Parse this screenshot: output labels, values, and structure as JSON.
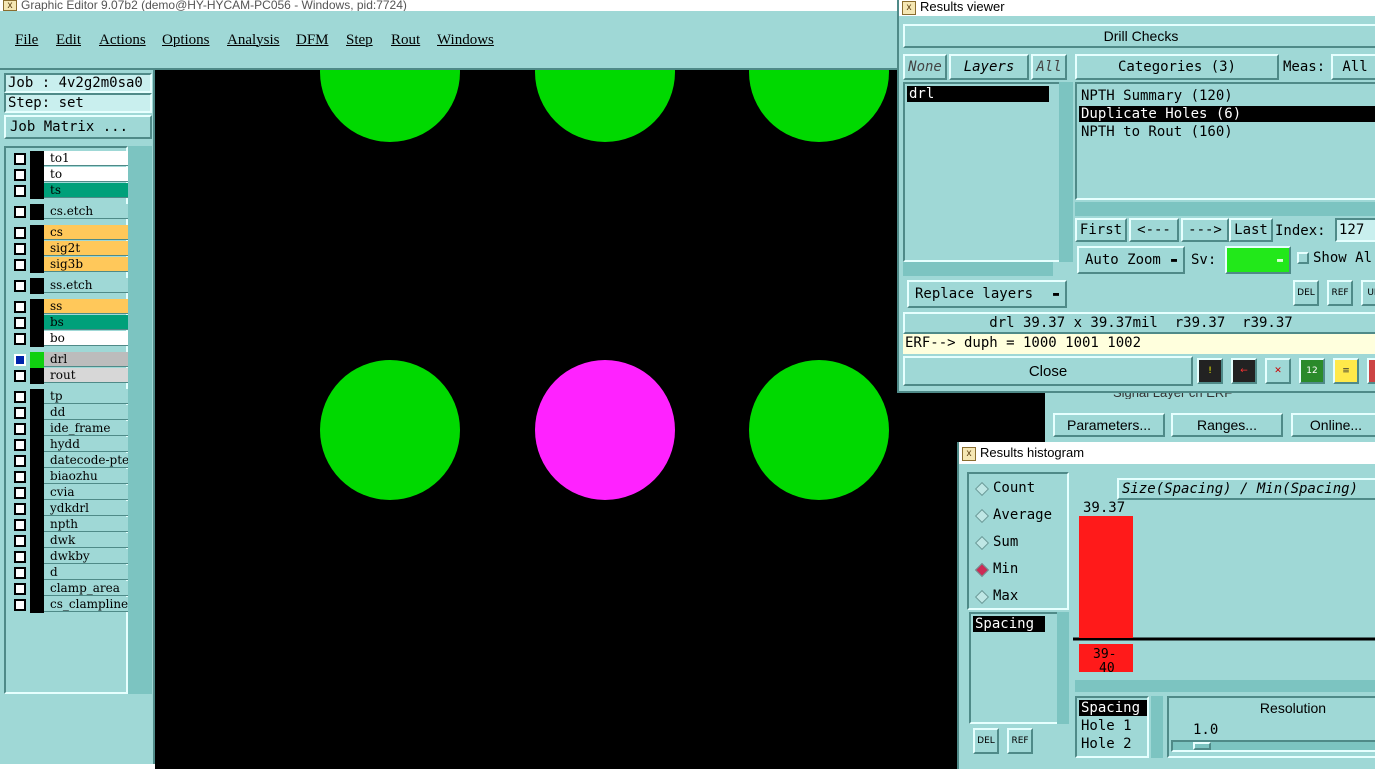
{
  "app": {
    "title": "Graphic Editor 9.07b2 (demo@HY-HYCAM-PC056 - Windows, pid:7724)",
    "menu": [
      "File",
      "Edit",
      "Actions",
      "Options",
      "Analysis",
      "DFM",
      "Step",
      "Rout",
      "Windows"
    ]
  },
  "side": {
    "job": "Job : 4v2g2m0sa0",
    "step": "Step: set",
    "job_matrix": "Job Matrix ...",
    "layers": [
      {
        "name": "to1",
        "color": "#ffffff"
      },
      {
        "name": "to",
        "color": "#ffffff"
      },
      {
        "name": "ts",
        "color": "#00a07a"
      },
      {
        "name": "cs.etch",
        "color": "#9fd8d6"
      },
      {
        "name": "cs",
        "color": "#ffc85a"
      },
      {
        "name": "sig2t",
        "color": "#ffc85a"
      },
      {
        "name": "sig3b",
        "color": "#ffc85a"
      },
      {
        "name": "ss.etch",
        "color": "#9fd8d6"
      },
      {
        "name": "ss",
        "color": "#ffc85a"
      },
      {
        "name": "bs",
        "color": "#00a07a"
      },
      {
        "name": "bo",
        "color": "#ffffff"
      },
      {
        "name": "drl",
        "color": "#bcbcbc"
      },
      {
        "name": "rout",
        "color": "#d7d7d7"
      },
      {
        "name": "tp",
        "color": "#9fd8d6"
      },
      {
        "name": "dd",
        "color": "#9fd8d6"
      },
      {
        "name": "ide_frame",
        "color": "#9fd8d6"
      },
      {
        "name": "hydd",
        "color": "#9fd8d6"
      },
      {
        "name": "datecode-pte",
        "color": "#9fd8d6"
      },
      {
        "name": "biaozhu",
        "color": "#9fd8d6"
      },
      {
        "name": "cvia",
        "color": "#9fd8d6"
      },
      {
        "name": "ydkdrl",
        "color": "#9fd8d6"
      },
      {
        "name": "npth",
        "color": "#9fd8d6"
      },
      {
        "name": "dwk",
        "color": "#9fd8d6"
      },
      {
        "name": "dwkby",
        "color": "#9fd8d6"
      },
      {
        "name": "d",
        "color": "#9fd8d6"
      },
      {
        "name": "clamp_area",
        "color": "#9fd8d6"
      },
      {
        "name": "cs_clampline",
        "color": "#9fd8d6"
      }
    ]
  },
  "canvas": {
    "holes": [
      {
        "color": "#00d900"
      },
      {
        "color": "#00d900"
      },
      {
        "color": "#00d900"
      },
      {
        "color": "#00d900"
      },
      {
        "color": "#ff22ff"
      },
      {
        "color": "#00d900"
      }
    ]
  },
  "results_viewer": {
    "title": "Results viewer",
    "header": "Drill Checks",
    "none_btn": "None",
    "layers_label": "Layers",
    "all_btn": "All",
    "categories_label": "Categories (3)",
    "meas_label": "Meas:",
    "meas_value": "All",
    "layer_items": [
      "drl"
    ],
    "categories": [
      "NPTH Summary (120)",
      "Duplicate Holes (6)",
      "NPTH to Rout (160)"
    ],
    "first": "First",
    "prev": "<---",
    "next": "--->",
    "last": "Last",
    "index_label": "Index:",
    "index_value": "127",
    "auto_zoom": "Auto Zoom",
    "sv_label": "Sv:",
    "show_all": "Show Al",
    "replace_layers": "Replace layers",
    "measure_text": "drl 39.37 x 39.37mil  r39.37  r39.37",
    "erf_text": "ERF--> duph = 1000 1001 1002",
    "close": "Close",
    "del": "DEL",
    "ref": "REF",
    "un": "UN"
  },
  "behind_panel": {
    "signal_text": "Signal Layer ch ERF",
    "parameters": "Parameters...",
    "ranges": "Ranges...",
    "online": "Online..."
  },
  "histogram": {
    "title": "Results histogram",
    "options": [
      "Count",
      "Average",
      "Sum",
      "Min",
      "Max"
    ],
    "selected": "Min",
    "list_items": [
      "Spacing"
    ],
    "chart_title": "Size(Spacing) / Min(Spacing)",
    "bar_value": "39.37",
    "bar_bin": "39-40",
    "bar_bin_line1": "39-",
    "bar_bin_line2": "40",
    "bar_color": "#ff1a1a",
    "info_items": [
      "Spacing",
      "Hole 1",
      "Hole 2"
    ],
    "resolution_label": "Resolution",
    "resolution_value": "1.0",
    "del": "DEL",
    "ref": "REF"
  }
}
